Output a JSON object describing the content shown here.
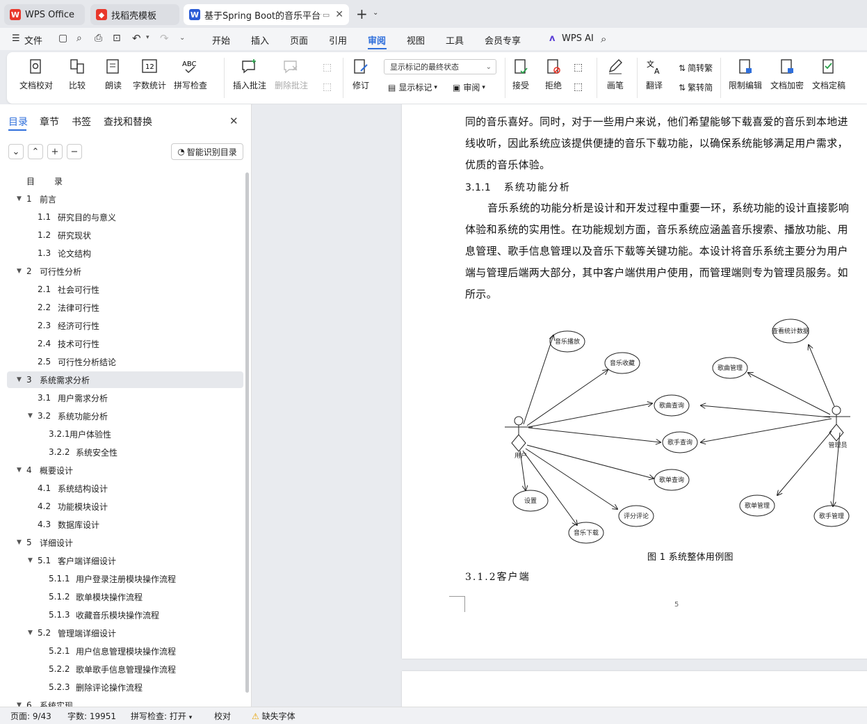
{
  "tabs": [
    {
      "label": "WPS Office"
    },
    {
      "label": "找稻壳模板"
    },
    {
      "label": "基于Spring Boot的音乐平台设"
    }
  ],
  "menu": {
    "file": "文件",
    "items": [
      "开始",
      "插入",
      "页面",
      "引用",
      "审阅",
      "视图",
      "工具",
      "会员专享"
    ],
    "active": "审阅",
    "wps_ai": "WPS AI"
  },
  "ribbon": {
    "doc_check": "文档校对",
    "compare": "比较",
    "read_aloud": "朗读",
    "word_count": "字数统计",
    "spell_check": "拼写检查",
    "insert_comment": "插入批注",
    "delete_comment": "删除批注",
    "track": "修订",
    "markup_state": "显示标记的最终状态",
    "show_markup": "显示标记",
    "review": "审阅",
    "accept": "接受",
    "reject": "拒绝",
    "pen": "画笔",
    "translate": "翻译",
    "to_traditional": "简转繁",
    "to_simplified": "繁转简",
    "restrict_edit": "限制编辑",
    "encrypt": "文档加密",
    "finalize": "文档定稿",
    "word_count_badge": "12"
  },
  "sidebar": {
    "tabs": [
      "目录",
      "章节",
      "书签",
      "查找和替换"
    ],
    "active_tab": "目录",
    "smart_toc": "智能识别目录",
    "toc": [
      {
        "num": "目",
        "text": "录",
        "level": 0,
        "arrow": ""
      },
      {
        "num": "1",
        "text": "前言",
        "level": 1,
        "arrow": "▼"
      },
      {
        "num": "1.1",
        "text": "研究目的与意义",
        "level": 2,
        "arrow": ""
      },
      {
        "num": "1.2",
        "text": "研究现状",
        "level": 2,
        "arrow": ""
      },
      {
        "num": "1.3",
        "text": "论文结构",
        "level": 2,
        "arrow": ""
      },
      {
        "num": "2",
        "text": "可行性分析",
        "level": 1,
        "arrow": "▼"
      },
      {
        "num": "2.1",
        "text": "社会可行性",
        "level": 2,
        "arrow": ""
      },
      {
        "num": "2.2",
        "text": "法律可行性",
        "level": 2,
        "arrow": ""
      },
      {
        "num": "2.3",
        "text": "经济可行性",
        "level": 2,
        "arrow": ""
      },
      {
        "num": "2.4",
        "text": "技术可行性",
        "level": 2,
        "arrow": ""
      },
      {
        "num": "2.5",
        "text": "可行性分析结论",
        "level": 2,
        "arrow": ""
      },
      {
        "num": "3",
        "text": "系统需求分析",
        "level": 1,
        "arrow": "▼",
        "selected": true
      },
      {
        "num": "3.1",
        "text": "用户需求分析",
        "level": 2,
        "arrow": ""
      },
      {
        "num": "3.2",
        "text": "系统功能分析",
        "level": 2,
        "arrow": "▼"
      },
      {
        "num": "3.2.1",
        "text": "用户体验性",
        "level": 3,
        "arrow": ""
      },
      {
        "num": "3.2.2",
        "text": "系统安全性",
        "level": 3,
        "arrow": ""
      },
      {
        "num": "4",
        "text": "概要设计",
        "level": 1,
        "arrow": "▼"
      },
      {
        "num": "4.1",
        "text": "系统结构设计",
        "level": 2,
        "arrow": ""
      },
      {
        "num": "4.2",
        "text": "功能模块设计",
        "level": 2,
        "arrow": ""
      },
      {
        "num": "4.3",
        "text": "数据库设计",
        "level": 2,
        "arrow": ""
      },
      {
        "num": "5",
        "text": "详细设计",
        "level": 1,
        "arrow": "▼"
      },
      {
        "num": "5.1",
        "text": "客户端详细设计",
        "level": 2,
        "arrow": "▼"
      },
      {
        "num": "5.1.1",
        "text": "用户登录注册模块操作流程",
        "level": 3,
        "arrow": ""
      },
      {
        "num": "5.1.2",
        "text": "歌单模块操作流程",
        "level": 3,
        "arrow": ""
      },
      {
        "num": "5.1.3",
        "text": "收藏音乐模块操作流程",
        "level": 3,
        "arrow": ""
      },
      {
        "num": "5.2",
        "text": "管理端详细设计",
        "level": 2,
        "arrow": "▼"
      },
      {
        "num": "5.2.1",
        "text": "用户信息管理模块操作流程",
        "level": 3,
        "arrow": ""
      },
      {
        "num": "5.2.2",
        "text": "歌单歌手信息管理操作流程",
        "level": 3,
        "arrow": ""
      },
      {
        "num": "5.2.3",
        "text": "删除评论操作流程",
        "level": 3,
        "arrow": ""
      },
      {
        "num": "6",
        "text": "系统实现",
        "level": 1,
        "arrow": "▼"
      }
    ]
  },
  "document": {
    "lines": [
      "同的音乐喜好。同时，对于一些用户来说，他们希望能够下载喜爱的音乐到本地进",
      "线收听，因此系统应该提供便捷的音乐下载功能，以确保系统能够满足用户需求，",
      "优质的音乐体验。"
    ],
    "heading_311_num": "3.1.1",
    "heading_311_text": "系统功能分析",
    "para": [
      "音乐系统的功能分析是设计和开发过程中重要一环，系统功能的设计直接影响",
      "体验和系统的实用性。在功能规划方面，音乐系统应涵盖音乐搜索、播放功能、用",
      "息管理、歌手信息管理以及音乐下载等关键功能。本设计将音乐系统主要分为用户",
      "端与管理后端两大部分，其中客户端供用户使用，而管理端则专为管理员服务。如",
      "所示。"
    ],
    "figure_caption": "图 1  系统整体用例图",
    "heading_312": "3.1.2客户端",
    "page_number": "5",
    "diagram": {
      "user_actor": "用户",
      "admin_actor": "管理员",
      "use_cases": [
        "音乐播放",
        "音乐收藏",
        "歌曲查询",
        "歌手查询",
        "歌单查询",
        "设置",
        "音乐下载",
        "评分评论",
        "查看统计数据",
        "歌曲管理",
        "歌单管理",
        "歌手管理"
      ]
    }
  },
  "status": {
    "page": "页面: 9/43",
    "words": "字数: 19951",
    "spell": "拼写检查: 打开",
    "proof": "校对",
    "missing_font": "缺失字体"
  },
  "colors": {
    "accent": "#2f6fdb",
    "wps_red": "#e8372b",
    "doc_blue": "#2b5cd6",
    "selected_row": "#e6e8ec"
  }
}
